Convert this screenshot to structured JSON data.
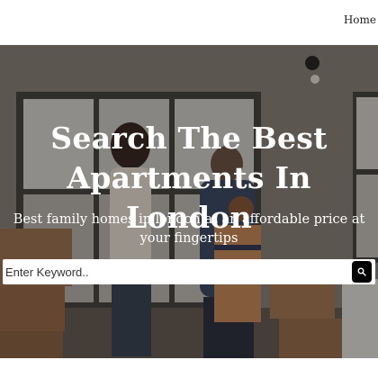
{
  "nav": {
    "links": [
      "Home"
    ]
  },
  "hero": {
    "title": "Search The Best Apartments In London",
    "subtitle": "Best family homes in london at an affordable price at your fingertips"
  },
  "search": {
    "placeholder": "Enter Keyword..",
    "value": "",
    "button_icon": "search-icon"
  },
  "colors": {
    "overlay": "#000000",
    "button": "#000000",
    "text_on_hero": "#ffffff"
  }
}
